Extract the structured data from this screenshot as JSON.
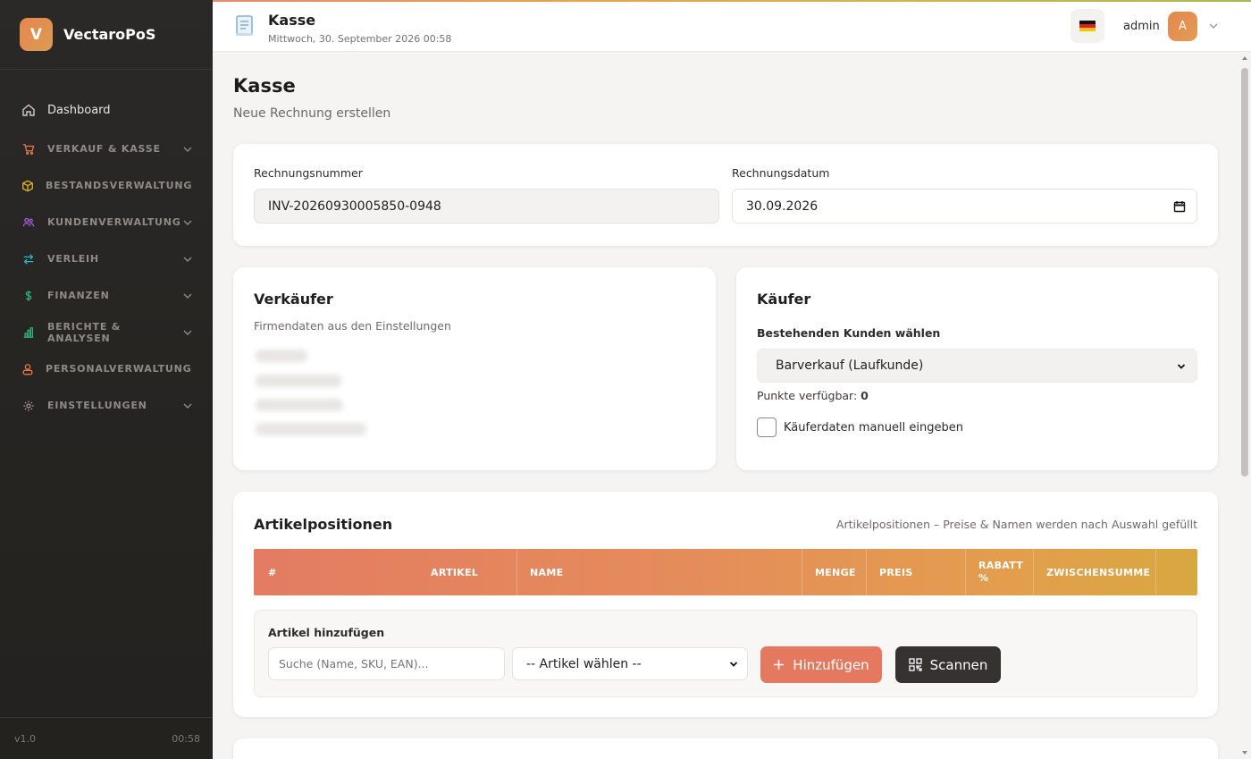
{
  "app": {
    "name": "VectaroPoS",
    "logo_letter": "V",
    "version": "v1.0",
    "clock": "00:58"
  },
  "sidebar": {
    "dashboard": "Dashboard",
    "groups": [
      {
        "label": "VERKAUF & KASSE",
        "icon": "cart-icon",
        "color": "#e5774f"
      },
      {
        "label": "BESTANDSVERWALTUNG",
        "icon": "box-icon",
        "color": "#e3b12b"
      },
      {
        "label": "KUNDENVERWALTUNG",
        "icon": "users-icon",
        "color": "#a35be0"
      },
      {
        "label": "VERLEIH",
        "icon": "swap-icon",
        "color": "#27b8c2"
      },
      {
        "label": "FINANZEN",
        "icon": "dollar-icon",
        "color": "#2fb07a"
      },
      {
        "label": "BERICHTE & ANALYSEN",
        "icon": "bar-chart-icon",
        "color": "#2fb07a"
      },
      {
        "label": "PERSONALVERWALTUNG",
        "icon": "person-icon",
        "color": "#e5774f"
      },
      {
        "label": "EINSTELLUNGEN",
        "icon": "gear-icon",
        "color": "#a09b95"
      }
    ]
  },
  "header": {
    "title": "Kasse",
    "datetime": "Mittwoch, 30. September 2026 00:58",
    "user": "admin",
    "avatar_letter": "A"
  },
  "page": {
    "title": "Kasse",
    "subtitle": "Neue Rechnung erstellen"
  },
  "invoice": {
    "number_label": "Rechnungsnummer",
    "number_value": "INV-20260930005850-0948",
    "date_label": "Rechnungsdatum",
    "date_value": "30.09.2026"
  },
  "seller": {
    "title": "Verkäufer",
    "description": "Firmendaten aus den Einstellungen"
  },
  "buyer": {
    "title": "Käufer",
    "select_label": "Bestehenden Kunden wählen",
    "selected_customer": "Barverkauf (Laufkunde)",
    "points_label": "Punkte verfügbar:",
    "points_value": "0",
    "manual_label": "Käuferdaten manuell eingeben"
  },
  "items": {
    "title": "Artikelpositionen",
    "hint": "Artikelpositionen – Preise & Namen werden nach Auswahl gefüllt",
    "columns": [
      "#",
      "ARTIKEL",
      "NAME",
      "MENGE",
      "PREIS",
      "RABATT %",
      "ZWISCHENSUMME"
    ],
    "add_label": "Artikel hinzufügen",
    "search_placeholder": "Suche (Name, SKU, EAN)...",
    "article_select": "-- Artikel wählen --",
    "add_button": "Hinzufügen",
    "scan_button": "Scannen"
  }
}
